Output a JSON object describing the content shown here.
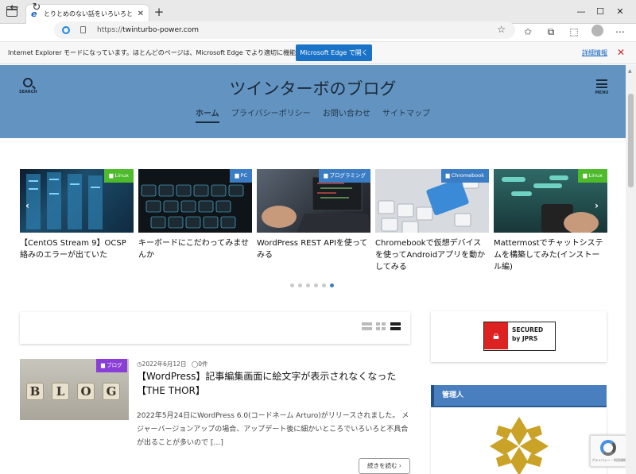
{
  "browser": {
    "tab_title": "とりとめのない話をいろいろと... | ツイ",
    "url_scheme": "https://",
    "url_host": "twinturbo-power.com",
    "colors": {
      "accent": "#1a73c7"
    }
  },
  "iemode": {
    "message": "Internet Explorer モードになっています。ほとんどのページは、Microsoft Edge でより適切に機能します。",
    "open_button": "Microsoft Edge で開く",
    "details": "詳細情報"
  },
  "site": {
    "search_label": "SEARCH",
    "menu_label": "MENU",
    "title": "ツインターボのブログ",
    "header_color": "#6394c1",
    "nav": [
      "ホーム",
      "プライバシーポリシー",
      "お問い合わせ",
      "サイトマップ"
    ]
  },
  "slider": {
    "cards": [
      {
        "category": "Linux",
        "cat_color": "#4dbb2b",
        "title": "【CentOS Stream 9】OCSP絡みのエラーが出ていた",
        "icon": "server-rack"
      },
      {
        "category": "PC",
        "cat_color": "#3b7dc4",
        "title": "キーボードにこだわってみませんか",
        "icon": "keyboard"
      },
      {
        "category": "プログラミング",
        "cat_color": "#3b7dc4",
        "title": "WordPress REST APIを使ってみる",
        "icon": "laptop-code"
      },
      {
        "category": "Chromebook",
        "cat_color": "#3b7dc4",
        "title": "Chromebookで仮想デバイスを使ってAndroidアプリを動かしてみる",
        "icon": "chromebook-keyboard"
      },
      {
        "category": "Linux",
        "cat_color": "#4dbb2b",
        "title": "Mattermostでチャットシステムを構築してみた(インストール編)",
        "icon": "chat-phone"
      }
    ],
    "active_dot": 6,
    "dot_count": 6
  },
  "post": {
    "category": "ブログ",
    "date": "2022年6月12日",
    "comments": "0件",
    "title": "【WordPress】記事編集画面に絵文字が表示されなくなった【THE THOR】",
    "excerpt": "2022年5月24日にWordPress 6.0(コードネーム Arturo)がリリースされました。 メジャーバージョンアップの場合、アップデート後に細かいところでいろいろと不具合が出ることが多いので […]",
    "blocks": [
      "B",
      "L",
      "O",
      "G"
    ],
    "more": "続きを読む"
  },
  "sidebar": {
    "secured_line1": "SECURED",
    "secured_line2": "by JPRS",
    "admin_heading": "管理人"
  }
}
